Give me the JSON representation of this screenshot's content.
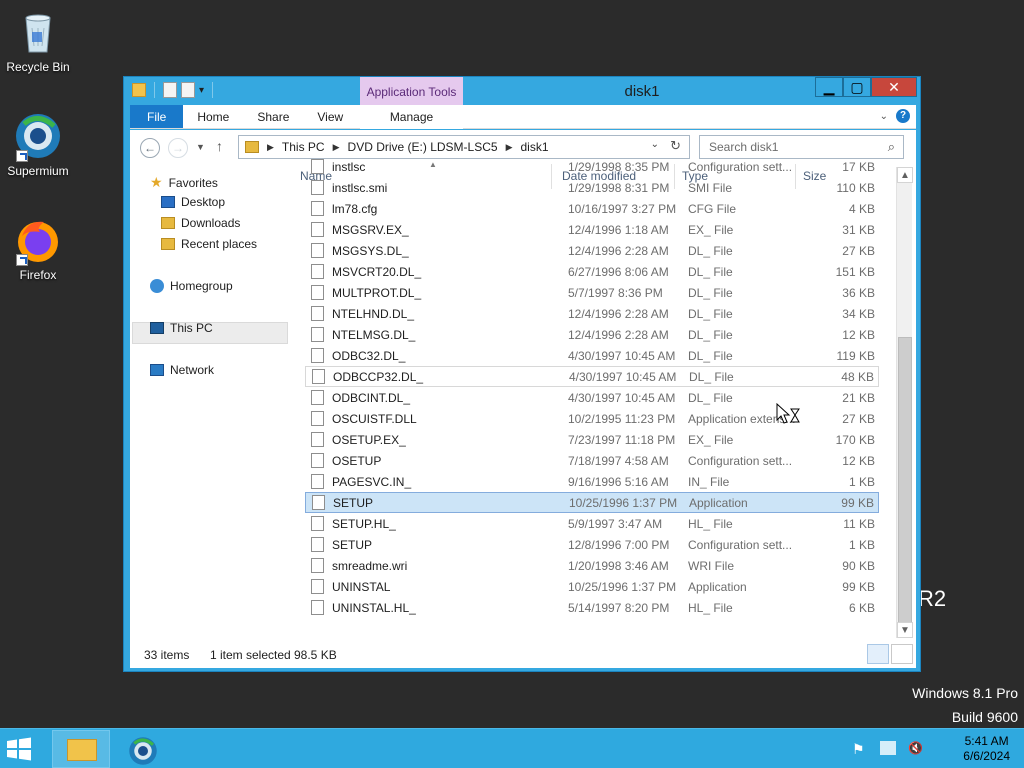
{
  "desktop": {
    "icons": [
      {
        "label": "Recycle Bin"
      },
      {
        "label": "Supermium"
      },
      {
        "label": "Firefox"
      }
    ],
    "watermark_line1": "Windows 8.1 Pro",
    "watermark_line2": "Build 9600",
    "r2_fragment": "R2"
  },
  "window": {
    "title": "disk1",
    "app_tools_label": "Application Tools",
    "buttons": {
      "minimize": "▁",
      "maximize": "▢",
      "close": "✕"
    }
  },
  "ribbon": {
    "tabs": [
      "File",
      "Home",
      "Share",
      "View"
    ],
    "manage_label": "Manage"
  },
  "nav": {
    "back": "←",
    "forward": "→",
    "up": "↑",
    "address": [
      "This PC",
      "DVD Drive (E:) LDSM-LSC5",
      "disk1"
    ],
    "search_placeholder": "Search disk1"
  },
  "navpane": {
    "favorites": "Favorites",
    "desktop": "Desktop",
    "downloads": "Downloads",
    "recent": "Recent places",
    "homegroup": "Homegroup",
    "thispc": "This PC",
    "network": "Network"
  },
  "columns": {
    "name": "Name",
    "date": "Date modified",
    "type": "Type",
    "size": "Size"
  },
  "files": [
    {
      "name": "instlsc",
      "date": "1/29/1998 8:35 PM",
      "type": "Configuration sett...",
      "size": "17 KB"
    },
    {
      "name": "instlsc.smi",
      "date": "1/29/1998 8:31 PM",
      "type": "SMI File",
      "size": "110 KB"
    },
    {
      "name": "lm78.cfg",
      "date": "10/16/1997 3:27 PM",
      "type": "CFG File",
      "size": "4 KB"
    },
    {
      "name": "MSGSRV.EX_",
      "date": "12/4/1996 1:18 AM",
      "type": "EX_ File",
      "size": "31 KB"
    },
    {
      "name": "MSGSYS.DL_",
      "date": "12/4/1996 2:28 AM",
      "type": "DL_ File",
      "size": "27 KB"
    },
    {
      "name": "MSVCRT20.DL_",
      "date": "6/27/1996 8:06 AM",
      "type": "DL_ File",
      "size": "151 KB"
    },
    {
      "name": "MULTPROT.DL_",
      "date": "5/7/1997 8:36 PM",
      "type": "DL_ File",
      "size": "36 KB"
    },
    {
      "name": "NTELHND.DL_",
      "date": "12/4/1996 2:28 AM",
      "type": "DL_ File",
      "size": "34 KB"
    },
    {
      "name": "NTELMSG.DL_",
      "date": "12/4/1996 2:28 AM",
      "type": "DL_ File",
      "size": "12 KB"
    },
    {
      "name": "ODBC32.DL_",
      "date": "4/30/1997 10:45 AM",
      "type": "DL_ File",
      "size": "119 KB"
    },
    {
      "name": "ODBCCP32.DL_",
      "date": "4/30/1997 10:45 AM",
      "type": "DL_ File",
      "size": "48 KB"
    },
    {
      "name": "ODBCINT.DL_",
      "date": "4/30/1997 10:45 AM",
      "type": "DL_ File",
      "size": "21 KB"
    },
    {
      "name": "OSCUISTF.DLL",
      "date": "10/2/1995 11:23 PM",
      "type": "Application extens...",
      "size": "27 KB"
    },
    {
      "name": "OSETUP.EX_",
      "date": "7/23/1997 11:18 PM",
      "type": "EX_ File",
      "size": "170 KB"
    },
    {
      "name": "OSETUP",
      "date": "7/18/1997 4:58 AM",
      "type": "Configuration sett...",
      "size": "12 KB"
    },
    {
      "name": "PAGESVC.IN_",
      "date": "9/16/1996 5:16 AM",
      "type": "IN_ File",
      "size": "1 KB"
    },
    {
      "name": "SETUP",
      "date": "10/25/1996 1:37 PM",
      "type": "Application",
      "size": "99 KB"
    },
    {
      "name": "SETUP.HL_",
      "date": "5/9/1997 3:47 AM",
      "type": "HL_ File",
      "size": "11 KB"
    },
    {
      "name": "SETUP",
      "date": "12/8/1996 7:00 PM",
      "type": "Configuration sett...",
      "size": "1 KB"
    },
    {
      "name": "smreadme.wri",
      "date": "1/20/1998 3:46 AM",
      "type": "WRI File",
      "size": "90 KB"
    },
    {
      "name": "UNINSTAL",
      "date": "10/25/1996 1:37 PM",
      "type": "Application",
      "size": "99 KB"
    },
    {
      "name": "UNINSTAL.HL_",
      "date": "5/14/1997 8:20 PM",
      "type": "HL_ File",
      "size": "6 KB"
    }
  ],
  "status": {
    "items": "33 items",
    "selected": "1 item selected",
    "size": "98.5 KB"
  },
  "taskbar": {
    "time": "5:41 AM",
    "date": "6/6/2024"
  }
}
